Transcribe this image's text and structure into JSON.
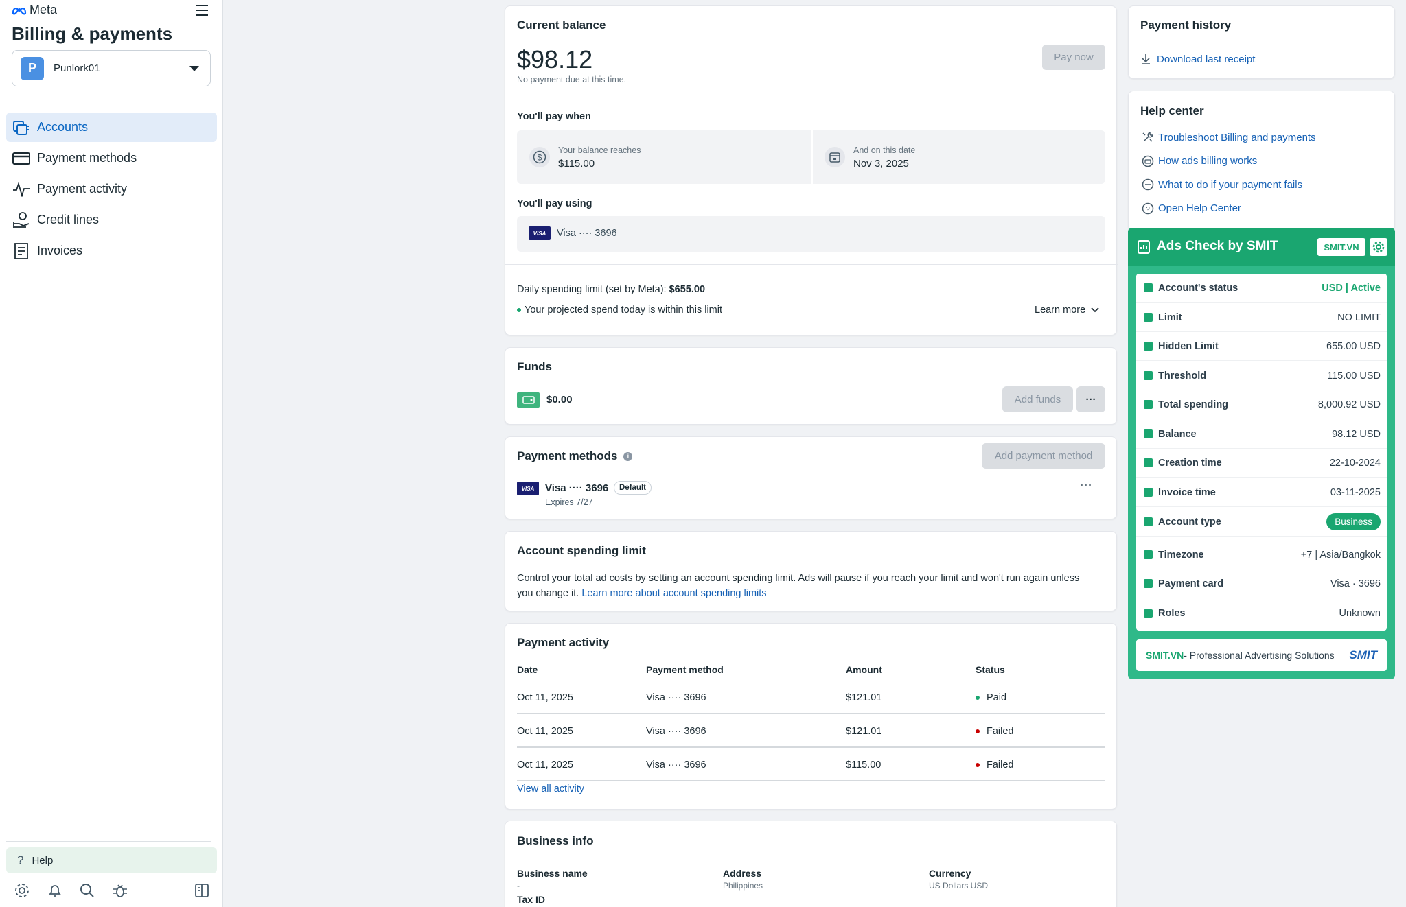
{
  "sidebar": {
    "logo_text": "Meta",
    "title": "Billing & payments",
    "account_initial": "P",
    "account_name": "Punlork01",
    "nav": [
      {
        "label": "Accounts",
        "icon": "accounts-icon"
      },
      {
        "label": "Payment methods",
        "icon": "card-icon"
      },
      {
        "label": "Payment activity",
        "icon": "activity-icon"
      },
      {
        "label": "Credit lines",
        "icon": "credit-lines-icon"
      },
      {
        "label": "Invoices",
        "icon": "invoice-icon"
      }
    ],
    "help_label": "Help"
  },
  "balance": {
    "title": "Current balance",
    "amount": "$98.12",
    "note": "No payment due at this time.",
    "pay_now": "Pay now",
    "pay_when_title": "You'll pay when",
    "reach_label": "Your balance reaches",
    "reach_value": "$115.00",
    "date_label": "And on this date",
    "date_value": "Nov 3, 2025",
    "pay_using_title": "You'll pay using",
    "card": "Visa ···· 3696",
    "daily_limit_label": "Daily spending limit (set by Meta): ",
    "daily_limit_value": "$655.00",
    "projected": "Your projected spend today is within this limit",
    "learn_more": "Learn more"
  },
  "funds": {
    "title": "Funds",
    "amount": "$0.00",
    "add_funds": "Add funds"
  },
  "payment_methods": {
    "title": "Payment methods",
    "add": "Add payment method",
    "card": "Visa ···· 3696",
    "default_badge": "Default",
    "expires": "Expires 7/27"
  },
  "spending_limit": {
    "title": "Account spending limit",
    "text": "Control your total ad costs by setting an account spending limit. Ads will pause if you reach your limit and won't run again unless you change it. ",
    "link": "Learn more about account spending limits"
  },
  "activity": {
    "title": "Payment activity",
    "columns": [
      "Date",
      "Payment method",
      "Amount",
      "Status"
    ],
    "rows": [
      {
        "date": "Oct 11, 2025",
        "method": "Visa ···· 3696",
        "amount": "$121.01",
        "status": "Paid",
        "color": "#1aa670"
      },
      {
        "date": "Oct 11, 2025",
        "method": "Visa ···· 3696",
        "amount": "$121.01",
        "status": "Failed",
        "color": "#c80000"
      },
      {
        "date": "Oct 11, 2025",
        "method": "Visa ···· 3696",
        "amount": "$115.00",
        "status": "Failed",
        "color": "#c80000"
      }
    ],
    "view_all": "View all activity"
  },
  "business": {
    "title": "Business info",
    "name_label": "Business name",
    "name_value": "-",
    "address_label": "Address",
    "address_value": "Philippines",
    "currency_label": "Currency",
    "currency_value": "US Dollars USD",
    "tax_label": "Tax ID"
  },
  "history": {
    "title": "Payment history",
    "download": "Download last receipt"
  },
  "help_center": {
    "title": "Help center",
    "links": [
      {
        "label": "Troubleshoot Billing and payments",
        "icon": "tools-icon"
      },
      {
        "label": "How ads billing works",
        "icon": "billing-icon"
      },
      {
        "label": "What to do if your payment fails",
        "icon": "minus-circle-icon"
      },
      {
        "label": "Open Help Center",
        "icon": "question-circle-icon"
      }
    ]
  },
  "smit": {
    "title": "Ads Check by SMIT",
    "badge": "SMIT.VN",
    "rows": [
      {
        "label": "Account's status",
        "value": "USD | Active"
      },
      {
        "label": "Limit",
        "value": "NO LIMIT"
      },
      {
        "label": "Hidden Limit",
        "value": "655.00 USD"
      },
      {
        "label": "Threshold",
        "value": "115.00 USD"
      },
      {
        "label": "Total spending",
        "value": "8,000.92 USD"
      },
      {
        "label": "Balance",
        "value": "98.12 USD"
      },
      {
        "label": "Creation time",
        "value": "22-10-2024"
      },
      {
        "label": "Invoice time",
        "value": "03-11-2025"
      },
      {
        "label": "Account type",
        "value": "Business"
      },
      {
        "label": "Timezone",
        "value": "+7 | Asia/Bangkok"
      },
      {
        "label": "Payment card",
        "value": "Visa · 3696"
      },
      {
        "label": "Roles",
        "value": "Unknown"
      }
    ],
    "footer_brand": "SMIT.VN",
    "footer_text": " - Professional Advertising Solutions",
    "footer_logo": "SMIT",
    "accent": "#1aa670"
  }
}
